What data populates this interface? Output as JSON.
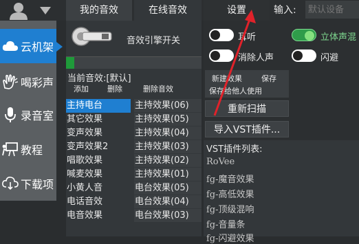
{
  "header": {
    "tabs": [
      {
        "label": "我的音效"
      },
      {
        "label": "在线音效"
      },
      {
        "label": "设置"
      }
    ],
    "input_label": "输入:",
    "input_placeholder": "默认设备"
  },
  "sidebar": {
    "items": [
      {
        "label": "云机架",
        "icon": "cloud-icon",
        "active": true
      },
      {
        "label": "喝彩声",
        "icon": "clap-icon"
      },
      {
        "label": "录音室",
        "icon": "microphone-icon"
      },
      {
        "label": "教程",
        "icon": "easel-icon"
      },
      {
        "label": "下载项",
        "icon": "cloud-download-icon"
      }
    ]
  },
  "engine": {
    "label": "音效引擎开关",
    "progress": 0.06
  },
  "current": {
    "label": "当前音效:[默认]"
  },
  "actions": {
    "add": "添加",
    "delete": "删除",
    "delete_effect": "删除音效"
  },
  "categories": [
    "主持电台",
    "其它效果",
    "变声效果",
    "变声效果2",
    "唱歌效果",
    "喊麦效果",
    "小黄人音",
    "电话音效",
    "电音效果"
  ],
  "effects": [
    "主持效果(06)",
    "主持效果(05)",
    "主持效果(04)",
    "主持效果(03)",
    "主持效果(02)",
    "主持效果(01)",
    "电台效果(05)",
    "电台效果(04)",
    "电台效果(03)"
  ],
  "toggles": {
    "reverb_listen": {
      "label": "耳听",
      "on": false
    },
    "stereo_mix": {
      "label": "立体声混",
      "on": true
    },
    "vocal_remove": {
      "label": "消除人声",
      "on": false
    },
    "avoid": {
      "label": "闪避",
      "on": false
    }
  },
  "fx_panel": {
    "new_effect": "新建效果",
    "save": "保存",
    "save_for_others": "保存给他人使用"
  },
  "buttons": {
    "rescan": "重新扫描",
    "import_vst": "导入VST插件..."
  },
  "vst": {
    "title": "VST插件列表:",
    "items": [
      "RoVee",
      "fg-魔音效果",
      "fg-高低效果",
      "fg-顶级混响",
      "fg-音量条",
      "fg-闪避效果"
    ]
  },
  "colors": {
    "accent": "#1f7fd1",
    "progress": "#1f9a3a",
    "arrow": "#e0222a"
  }
}
